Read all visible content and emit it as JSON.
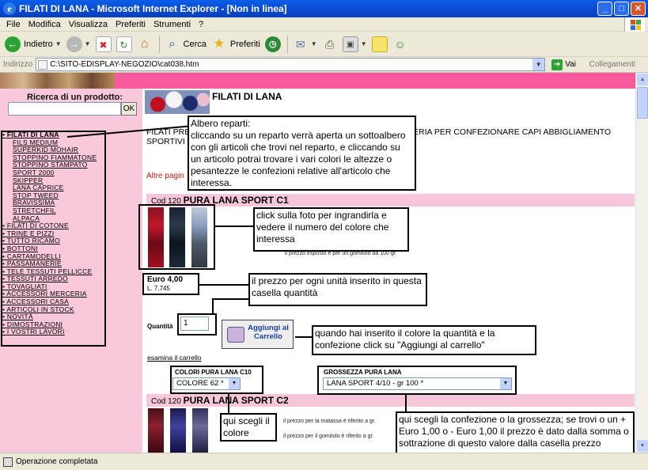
{
  "window": {
    "title": "FILATI DI LANA - Microsoft Internet Explorer - [Non in linea]",
    "minimize": "_",
    "maximize": "□",
    "close": "✕"
  },
  "menu": [
    "File",
    "Modifica",
    "Visualizza",
    "Preferiti",
    "Strumenti",
    "?"
  ],
  "toolbar": {
    "back": "Indietro",
    "search": "Cerca",
    "favorites": "Preferiti"
  },
  "address": {
    "label": "Indirizzo",
    "url": "C:\\SITO-EDISPLAY-NEGOZIO\\cat038.htm",
    "go": "Vai",
    "links": "Collegamenti"
  },
  "page": {
    "search_title": "Ricerca di un prodotto:",
    "search_ok": "OK",
    "title": "FILATI DI LANA",
    "intro_left": "FILATI PRE",
    "intro_left2": "SPORTIVI",
    "intro_right": "ERIA PER CONFEZIONARE CAPI ABBIGLIAMENTO",
    "altre": "Altre pagin",
    "nav": [
      {
        "label": "FILATI DI LANA",
        "level": "top",
        "bold": true
      },
      {
        "label": "FILS MEDIUM",
        "level": "sub"
      },
      {
        "label": "SUPERKID MOHAIR",
        "level": "sub"
      },
      {
        "label": "STOPPINO FIAMMATONE",
        "level": "sub"
      },
      {
        "label": "STOPPINO STAMPATO",
        "level": "sub"
      },
      {
        "label": "SPORT 2000",
        "level": "sub"
      },
      {
        "label": "SKIPPER",
        "level": "sub"
      },
      {
        "label": "LANA CAPRICE",
        "level": "sub"
      },
      {
        "label": "STOP TWEED",
        "level": "sub"
      },
      {
        "label": "BRAVISSIMA",
        "level": "sub"
      },
      {
        "label": "STRETCHFIL",
        "level": "sub"
      },
      {
        "label": "ALPACA",
        "level": "sub"
      },
      {
        "label": "FILATI DI COTONE",
        "level": "top"
      },
      {
        "label": "TRINE E PIZZI",
        "level": "top"
      },
      {
        "label": "TUTTO RICAMO",
        "level": "top"
      },
      {
        "label": "BOTTONI",
        "level": "top"
      },
      {
        "label": "CARTAMODELLI",
        "level": "top"
      },
      {
        "label": "PASSAMANERIE",
        "level": "top"
      },
      {
        "label": "TELE TESSUTI PELLICCE",
        "level": "top"
      },
      {
        "label": "TESSUTI ARREDO",
        "level": "top"
      },
      {
        "label": "TOVAGLIATI",
        "level": "top"
      },
      {
        "label": "ACCESSORI MERCERIA",
        "level": "top"
      },
      {
        "label": "ACCESSORI CASA",
        "level": "top"
      },
      {
        "label": "ARTICOLI IN STOCK",
        "level": "top"
      },
      {
        "label": "NOVITÀ",
        "level": "top"
      },
      {
        "label": "DIMOSTRAZIONI",
        "level": "top"
      },
      {
        "label": "I VOSTRI LAVORI",
        "level": "top"
      }
    ],
    "product1": {
      "code": "Cod 120",
      "name": "PURA LANA SPORT C1"
    },
    "product2": {
      "code": "Cod 120",
      "name": "PURA LANA SPORT C2"
    },
    "small1": "il prezzo esposto è per un gomitolo da 100 gr.",
    "price": "Euro 4,00",
    "price_lire": "L. 7.745",
    "qty_label": "Quantità",
    "qty_value": "1",
    "cart_button": "Aggiungi al Carrello",
    "cart_link": "esamina il carrello",
    "colors_label": "COLORI PURA LANA C10",
    "colors_value": "COLORE 62 *",
    "size_label": "GROSSEZZA PURA LANA",
    "size_value": "LANA SPORT 4/10 - gr 100 *",
    "small2": "il prezzo per la matassa è riferito a gr.",
    "small3": "il prezzo per il gomitolo è riferito a gr."
  },
  "callouts": {
    "albero": "Albero reparti:\ncliccando su un reparto verrà aperta un sottoalbero con gli articoli che trovi nel reparto, e cliccando su un articolo potrai trovare i vari colori le altezze o pesantezze le confezioni relative all'articolo che interessa.",
    "foto": "click sulla foto per ingrandirla e vedere il numero del colore che interessa",
    "prezzo": "il prezzo per ogni unità inserito in questa casella quantità",
    "carrello": "quando hai inserito il colore la quantità e la confezione click su \"Aggiungi al carrello\"",
    "colore": "qui scegli il colore",
    "confezione": "qui scegli la confezione o la grossezza; se trovi  o un + Euro 1,00 o - Euro 1,00 il prezzo è dato dalla somma o sottrazione di questo valore dalla casella prezzo"
  },
  "status": "Operazione completata"
}
